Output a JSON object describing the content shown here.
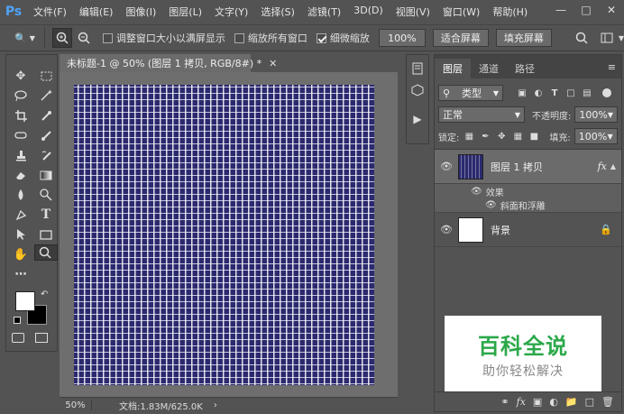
{
  "app": {
    "logo": "Ps"
  },
  "menu": [
    "文件(F)",
    "编辑(E)",
    "图像(I)",
    "图层(L)",
    "文字(Y)",
    "选择(S)",
    "滤镜(T)",
    "3D(D)",
    "视图(V)",
    "窗口(W)",
    "帮助(H)"
  ],
  "options": {
    "resize_windows": "调整窗口大小以满屏显示",
    "resize_windows_checked": false,
    "zoom_all": "缩放所有窗口",
    "zoom_all_checked": false,
    "scrubby_zoom": "细微缩放",
    "scrubby_zoom_checked": true,
    "zoom_value": "100%",
    "fit_screen": "适合屏幕",
    "fill_screen": "填充屏幕"
  },
  "document": {
    "tab_title": "未标题-1 @ 50% (图层 1 拷贝, RGB/8#) *",
    "zoom": "50%",
    "doc_size": "文档:1.83M/625.0K"
  },
  "panel_tabs": [
    "图层",
    "通道",
    "路径"
  ],
  "layers_panel": {
    "filter_kind": "类型",
    "blend_mode": "正常",
    "opacity_label": "不透明度:",
    "opacity_value": "100%",
    "lock_label": "锁定:",
    "fill_label": "填充:",
    "fill_value": "100%",
    "layers": [
      {
        "name": "图层 1 拷贝",
        "fx": "fx",
        "effects_label": "效果",
        "effect": "斜面和浮雕"
      },
      {
        "name": "背景"
      }
    ]
  },
  "watermark": {
    "line1": "百科全说",
    "line2": "助你轻松解决"
  },
  "colors": {
    "bg": "#535353",
    "accent": "#4fa3f7",
    "canvas": "#2b2a6e",
    "watermark_green": "#2ba84a"
  }
}
